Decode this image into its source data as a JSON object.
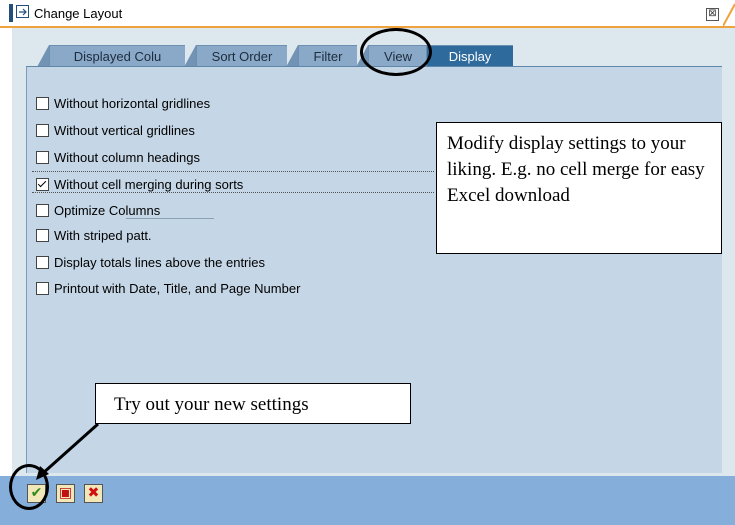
{
  "window": {
    "title": "Change Layout",
    "close_glyph": "⊠"
  },
  "tabs": [
    {
      "label": "Displayed Colu",
      "active": false
    },
    {
      "label": "Sort Order",
      "active": false
    },
    {
      "label": "Filter",
      "active": false
    },
    {
      "label": "View",
      "active": false
    },
    {
      "label": "Display",
      "active": true
    }
  ],
  "options": [
    {
      "label": "Without horizontal gridlines",
      "checked": false
    },
    {
      "label": "Without vertical gridlines",
      "checked": false
    },
    {
      "label": "Without column headings",
      "checked": false
    },
    {
      "label": "Without cell merging during sorts",
      "checked": true
    },
    {
      "label": "Optimize Columns",
      "checked": false
    },
    {
      "label": "With striped patt.",
      "checked": false
    },
    {
      "label": "Display totals lines above the entries",
      "checked": false
    },
    {
      "label": "Printout with Date, Title, and Page Number",
      "checked": false
    }
  ],
  "toolbar": {
    "ok_icon": "checkmark-icon",
    "ok_glyph": "✔",
    "save_icon": "save-icon",
    "save_glyph": "▣",
    "cancel_icon": "cancel-x-icon",
    "cancel_glyph": "✖"
  },
  "annotations": {
    "modify_text": "Modify display settings to your liking. E.g. no cell merge for easy Excel download",
    "try_text": "Try out your new settings"
  },
  "colors": {
    "panel_bg": "#c5d6e6",
    "tab_active": "#2f6a9d",
    "footer_bg": "#86aedb",
    "title_underline": "#f0a33c"
  }
}
